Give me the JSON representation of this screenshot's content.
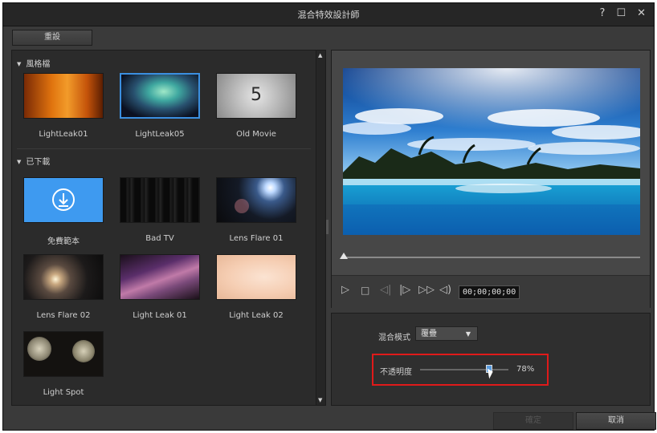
{
  "window": {
    "title": "混合特效設計師",
    "help": "?",
    "maximize": "☐",
    "close": "✕"
  },
  "toolbar": {
    "reset_label": "重設"
  },
  "library": {
    "section_styles": "風格檔",
    "section_downloaded": "已下載",
    "styles": [
      {
        "label": "LightLeak01"
      },
      {
        "label": "LightLeak05"
      },
      {
        "label": "Old Movie",
        "glyph": "5"
      }
    ],
    "downloaded": [
      {
        "label": "免費範本"
      },
      {
        "label": "Bad TV"
      },
      {
        "label": "Lens Flare 01"
      },
      {
        "label": "Lens Flare 02"
      },
      {
        "label": "Light Leak 01"
      },
      {
        "label": "Light Leak 02"
      },
      {
        "label": "Light Spot"
      }
    ]
  },
  "player": {
    "timecode": "00;00;00;00",
    "position_fraction": 0.0
  },
  "settings": {
    "blend_label": "混合模式",
    "blend_value": "覆疊",
    "opacity_label": "不透明度",
    "opacity_value": "78%",
    "opacity_fraction": 0.78
  },
  "footer": {
    "ok_label": "確定",
    "cancel_label": "取消"
  }
}
